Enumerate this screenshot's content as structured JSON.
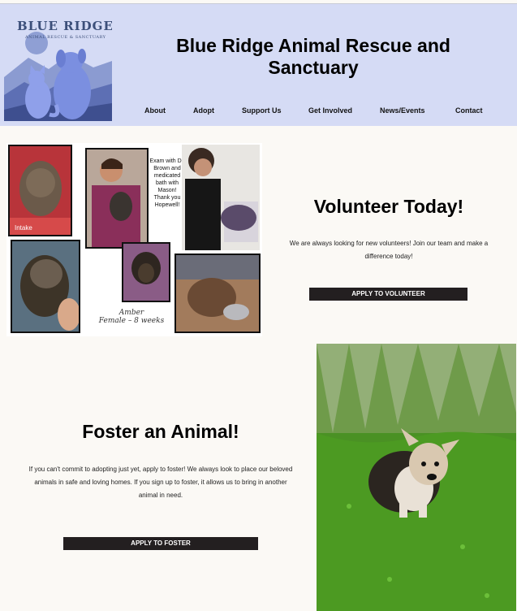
{
  "header": {
    "logo": {
      "title": "BLUE RIDGE",
      "subtitle": "ANIMAL RESCUE & SANCTUARY",
      "icon": "mountain-cat-dog-logo"
    },
    "site_title": "Blue Ridge Animal Rescue and Sanctuary",
    "nav": [
      "About",
      "Adopt",
      "Support Us",
      "Get Involved",
      "News/Events",
      "Contact"
    ]
  },
  "volunteer": {
    "collage": {
      "intake_label": "Intake",
      "note": "Exam with Dr. Brown and medicated bath with Mason! Thank you Hopewell!",
      "caption_line1": "Amber",
      "caption_line2": "Female – 8 weeks"
    },
    "title": "Volunteer Today!",
    "text": "We are always looking for new volunteers! Join our team and make a difference today!",
    "button": "Apply to Volunteer"
  },
  "foster": {
    "title": "Foster an Animal!",
    "text": "If you can't commit to adopting just yet, apply to foster! We always look to place our beloved animals in safe and loving homes. If you sign up to foster, it allows us to bring in another animal in need.",
    "button": "Apply to Foster",
    "photo": "small dog sitting in green grass"
  },
  "colors": {
    "header_bg": "#d5dbf5",
    "page_bg": "#fbf9f5",
    "button_bg": "#231f20",
    "logo_blue": "#3c4f7a"
  }
}
